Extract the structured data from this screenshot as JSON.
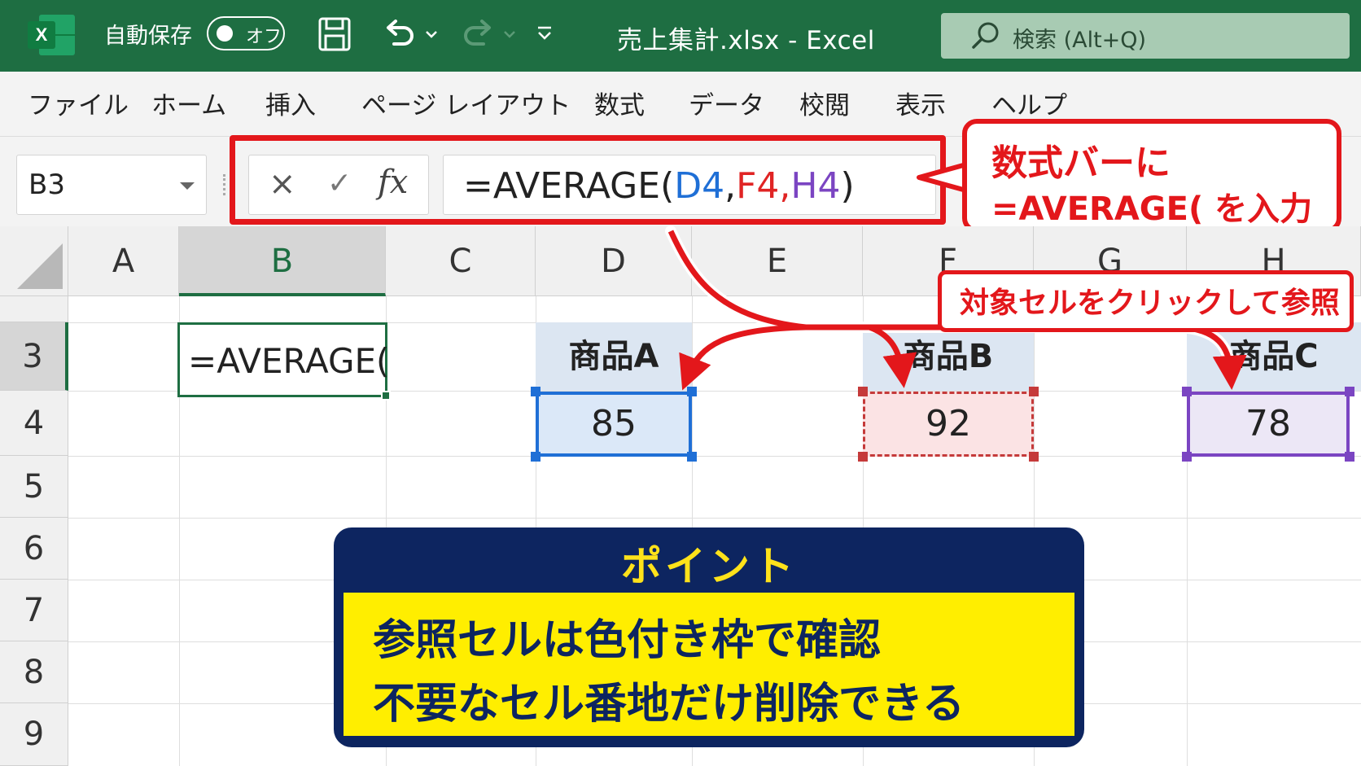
{
  "titlebar": {
    "app_icon": "excel-logo",
    "app_letter": "X",
    "autosave_label": "自動保存",
    "autosave_state": "オフ",
    "title": "売上集計.xlsx  -  Excel",
    "search_placeholder": "検索 (Alt+Q)",
    "colors": {
      "bar": "#1e6e42",
      "search": "#a8cbb3"
    }
  },
  "ribbon": {
    "tabs": [
      "ファイル",
      "ホーム",
      "挿入",
      "ページ レイアウト",
      "数式",
      "データ",
      "校閲",
      "表示",
      "ヘルプ"
    ]
  },
  "formula_bar": {
    "name_box": "B3",
    "cancel_icon": "×",
    "enter_icon": "✓",
    "fx_label": "fx",
    "formula_prefix": "=AVERAGE(",
    "ref1": "D4",
    "comma1": ",",
    "ref2": "F4",
    "comma2": ",",
    "ref3": "H4",
    "formula_suffix": ")"
  },
  "callouts": {
    "formula_bar_note_line1": "数式バーに",
    "formula_bar_note_line2": "=AVERAGE( を入力",
    "click_note": "対象セルをクリックして参照"
  },
  "sheet": {
    "columns": [
      "A",
      "B",
      "C",
      "D",
      "E",
      "F",
      "G",
      "H"
    ],
    "rows": [
      "3",
      "4",
      "5",
      "6",
      "7",
      "8",
      "9"
    ],
    "cell_b3": "=AVERAGE(",
    "products": [
      {
        "cell": "D3",
        "name": "商品A",
        "ref": "D4",
        "value": "85",
        "color": "#1f6fd6"
      },
      {
        "cell": "F3",
        "name": "商品B",
        "ref": "F4",
        "value": "92",
        "color": "#e02424"
      },
      {
        "cell": "H3",
        "name": "商品C",
        "ref": "H4",
        "value": "78",
        "color": "#7b45c2"
      }
    ]
  },
  "point": {
    "title": "ポイント",
    "line1": "参照セルは色付き枠で確認",
    "line2": "不要なセル番地だけ削除できる",
    "colors": {
      "panel": "#0d2560",
      "highlight": "#ffee00",
      "title": "#ffe21a"
    }
  }
}
